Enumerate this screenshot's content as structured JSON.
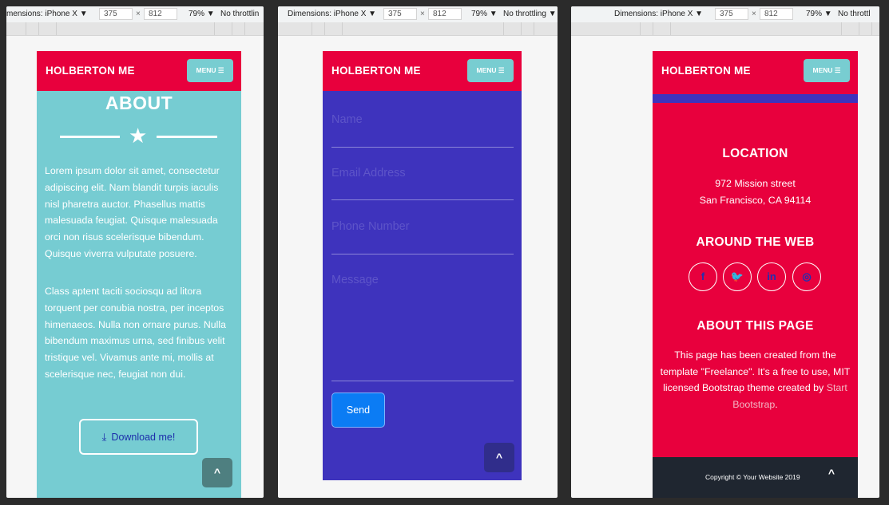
{
  "devtools": {
    "p1": {
      "dimensions_label": "mensions: iPhone X ▼",
      "width": "375",
      "times": "×",
      "height": "812",
      "zoom": "79% ▼",
      "throttling": "No throttlin"
    },
    "p2": {
      "dimensions_label": "Dimensions: iPhone X ▼",
      "width": "375",
      "times": "×",
      "height": "812",
      "zoom": "79% ▼",
      "throttling": "No throttling ▼"
    },
    "p3": {
      "dimensions_label": "Dimensions: iPhone X ▼",
      "width": "375",
      "times": "×",
      "height": "812",
      "zoom": "79% ▼",
      "throttling": "No throttl"
    }
  },
  "navbar": {
    "brand": "HOLBERTON ME",
    "menu_label": "MENU ☰"
  },
  "about": {
    "title": "ABOUT",
    "star_icon": "★",
    "paragraph1": "Lorem ipsum dolor sit amet, consectetur adipiscing elit. Nam blandit turpis iaculis nisl pharetra auctor. Phasellus mattis malesuada feugiat. Quisque malesuada orci non risus scelerisque bibendum. Quisque viverra vulputate posuere.",
    "paragraph2": "Class aptent taciti sociosqu ad litora torquent per conubia nostra, per inceptos himenaeos. Nulla non ornare purus. Nulla bibendum maximus urna, sed finibus velit tristique vel. Vivamus ante mi, mollis at scelerisque nec, feugiat non dui.",
    "download_label": "Download me!",
    "download_icon": "⤓"
  },
  "contact": {
    "name_placeholder": "Name",
    "email_placeholder": "Email Address",
    "phone_placeholder": "Phone Number",
    "message_placeholder": "Message",
    "send_label": "Send"
  },
  "footer": {
    "location_title": "LOCATION",
    "address_line1": "972 Mission street",
    "address_line2": "San Francisco, CA 94114",
    "web_title": "AROUND THE WEB",
    "socials": {
      "facebook": "f",
      "twitter": "🐦",
      "linkedin": "in",
      "dribbble": "◎"
    },
    "about_title": "ABOUT THIS PAGE",
    "about_text_before": "This page has been created from the template \"Freelance\". It's a free to use, MIT licensed Bootstrap theme created by ",
    "about_link": "Start Bootstrap",
    "about_text_after": ".",
    "copyright": "Copyright © Your Website 2019"
  },
  "scroll_top_icon": "^",
  "colors": {
    "nav": "#e8003d",
    "teal": "#76ccd2",
    "indigo": "#3e33bd",
    "dark": "#1f2630",
    "send": "#0b7cf4"
  }
}
